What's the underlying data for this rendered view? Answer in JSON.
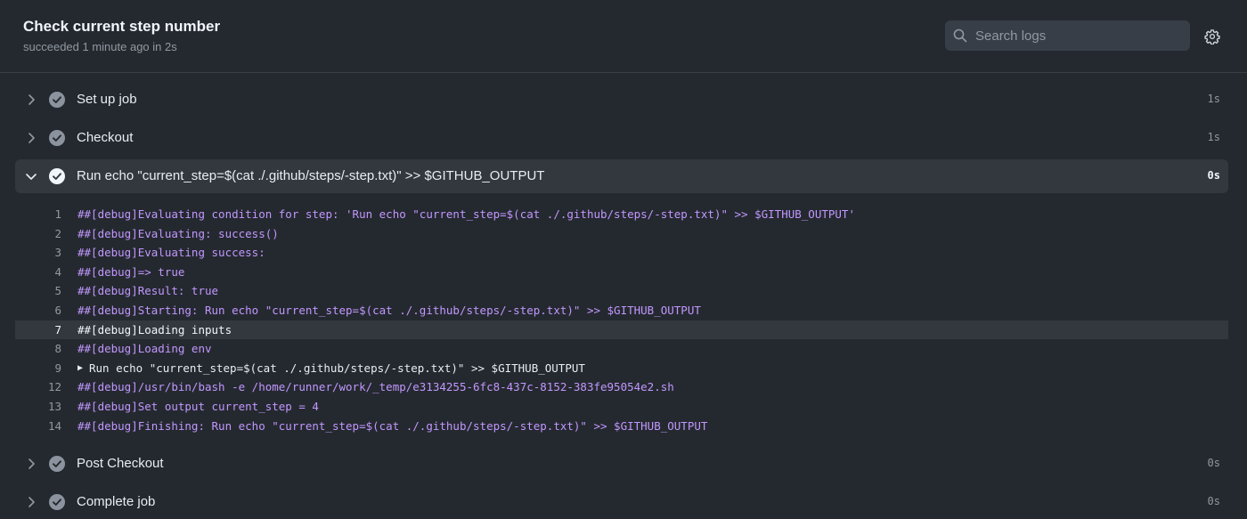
{
  "header": {
    "title": "Check current step number",
    "subtitle": "succeeded 1 minute ago in 2s",
    "search_placeholder": "Search logs"
  },
  "steps_before": [
    {
      "label": "Set up job",
      "duration": "1s"
    },
    {
      "label": "Checkout",
      "duration": "1s"
    }
  ],
  "expanded_step": {
    "label": "Run echo \"current_step=$(cat ./.github/steps/-step.txt)\" >> $GITHUB_OUTPUT",
    "duration": "0s"
  },
  "log_lines": [
    {
      "n": "1",
      "text": "##[debug]Evaluating condition for step: 'Run echo \"current_step=$(cat ./.github/steps/-step.txt)\" >> $GITHUB_OUTPUT'"
    },
    {
      "n": "2",
      "text": "##[debug]Evaluating: success()"
    },
    {
      "n": "3",
      "text": "##[debug]Evaluating success:"
    },
    {
      "n": "4",
      "text": "##[debug]=> true"
    },
    {
      "n": "5",
      "text": "##[debug]Result: true"
    },
    {
      "n": "6",
      "text": "##[debug]Starting: Run echo \"current_step=$(cat ./.github/steps/-step.txt)\" >> $GITHUB_OUTPUT"
    },
    {
      "n": "7",
      "text": "##[debug]Loading inputs"
    },
    {
      "n": "8",
      "text": "##[debug]Loading env"
    },
    {
      "n": "9",
      "text": "Run echo \"current_step=$(cat ./.github/steps/-step.txt)\" >> $GITHUB_OUTPUT"
    },
    {
      "n": "12",
      "text": "##[debug]/usr/bin/bash -e /home/runner/work/_temp/e3134255-6fc8-437c-8152-383fe95054e2.sh"
    },
    {
      "n": "13",
      "text": "##[debug]Set output current_step = 4"
    },
    {
      "n": "14",
      "text": "##[debug]Finishing: Run echo \"current_step=$(cat ./.github/steps/-step.txt)\" >> $GITHUB_OUTPUT"
    }
  ],
  "steps_after": [
    {
      "label": "Post Checkout",
      "duration": "0s"
    },
    {
      "label": "Complete job",
      "duration": "0s"
    }
  ],
  "colors": {
    "background": "#24292f",
    "debug_text": "#c297ff",
    "success_icon": "#8b949e"
  }
}
